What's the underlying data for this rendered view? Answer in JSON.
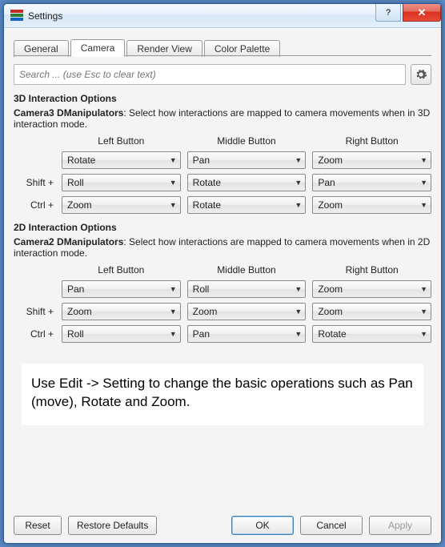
{
  "window": {
    "title": "Settings"
  },
  "tabs": {
    "general": "General",
    "camera": "Camera",
    "render_view": "Render View",
    "color_palette": "Color Palette"
  },
  "search": {
    "placeholder": "Search ... (use Esc to clear text)"
  },
  "section3d": {
    "heading": "3D Interaction Options",
    "desc_bold": "Camera3 DManipulators",
    "desc_rest": ": Select how interactions are mapped to camera movements when in 3D interaction mode.",
    "cols": {
      "left": "Left Button",
      "middle": "Middle Button",
      "right": "Right Button"
    },
    "rows": {
      "none_label": "",
      "shift_label": "Shift +",
      "ctrl_label": "Ctrl +"
    },
    "values": {
      "none": {
        "left": "Rotate",
        "middle": "Pan",
        "right": "Zoom"
      },
      "shift": {
        "left": "Roll",
        "middle": "Rotate",
        "right": "Pan"
      },
      "ctrl": {
        "left": "Zoom",
        "middle": "Rotate",
        "right": "Zoom"
      }
    }
  },
  "section2d": {
    "heading": "2D Interaction Options",
    "desc_bold": "Camera2 DManipulators",
    "desc_rest": ": Select how interactions are mapped to camera movements when in 2D interaction mode.",
    "cols": {
      "left": "Left Button",
      "middle": "Middle Button",
      "right": "Right Button"
    },
    "rows": {
      "none_label": "",
      "shift_label": "Shift +",
      "ctrl_label": "Ctrl +"
    },
    "values": {
      "none": {
        "left": "Pan",
        "middle": "Roll",
        "right": "Zoom"
      },
      "shift": {
        "left": "Zoom",
        "middle": "Zoom",
        "right": "Zoom"
      },
      "ctrl": {
        "left": "Roll",
        "middle": "Pan",
        "right": "Rotate"
      }
    }
  },
  "hint": "Use Edit -> Setting to change the basic operations such as Pan (move), Rotate and Zoom.",
  "footer": {
    "reset": "Reset",
    "restore": "Restore Defaults",
    "ok": "OK",
    "cancel": "Cancel",
    "apply": "Apply"
  }
}
